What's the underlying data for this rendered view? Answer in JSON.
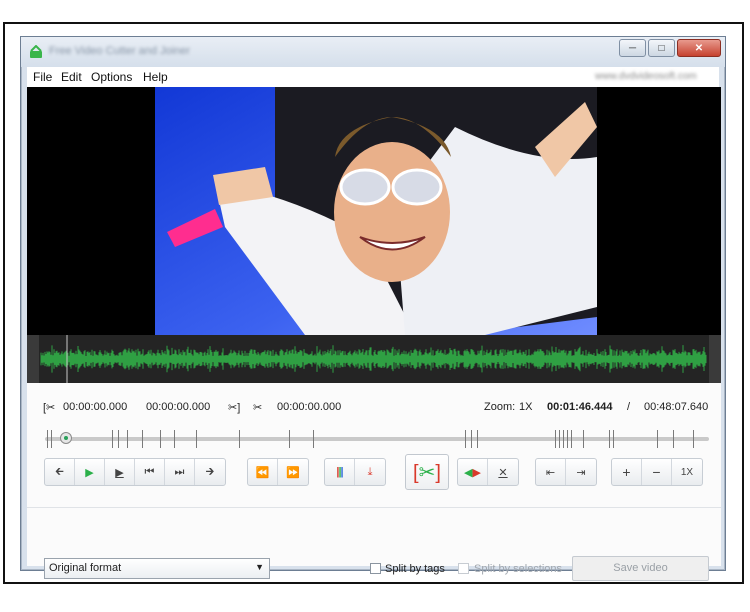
{
  "window": {
    "title": "Free Video Cutter and Joiner",
    "controls": [
      "minimize",
      "maximize",
      "close"
    ]
  },
  "menu": [
    "File",
    "Edit",
    "Options",
    "Help"
  ],
  "menu_right_text": "www.dvdvideosoft.com",
  "times": {
    "start": "00:00:00.000",
    "end": "00:00:00.000",
    "selection": "00:00:00.000",
    "zoom_label": "Zoom:",
    "zoom_value": "1X",
    "current": "00:01:46.444",
    "separator": "/",
    "total": "00:48:07.640"
  },
  "toolbar": {
    "speed_label": "1X"
  },
  "bottom": {
    "format": "Original format",
    "split_by_tags": "Split by tags",
    "split_by_selections": "Split by selections",
    "save": "Save video"
  },
  "colors": {
    "wave": "#2fa043",
    "accent_green": "#2bb04a",
    "accent_red": "#d9392b"
  }
}
